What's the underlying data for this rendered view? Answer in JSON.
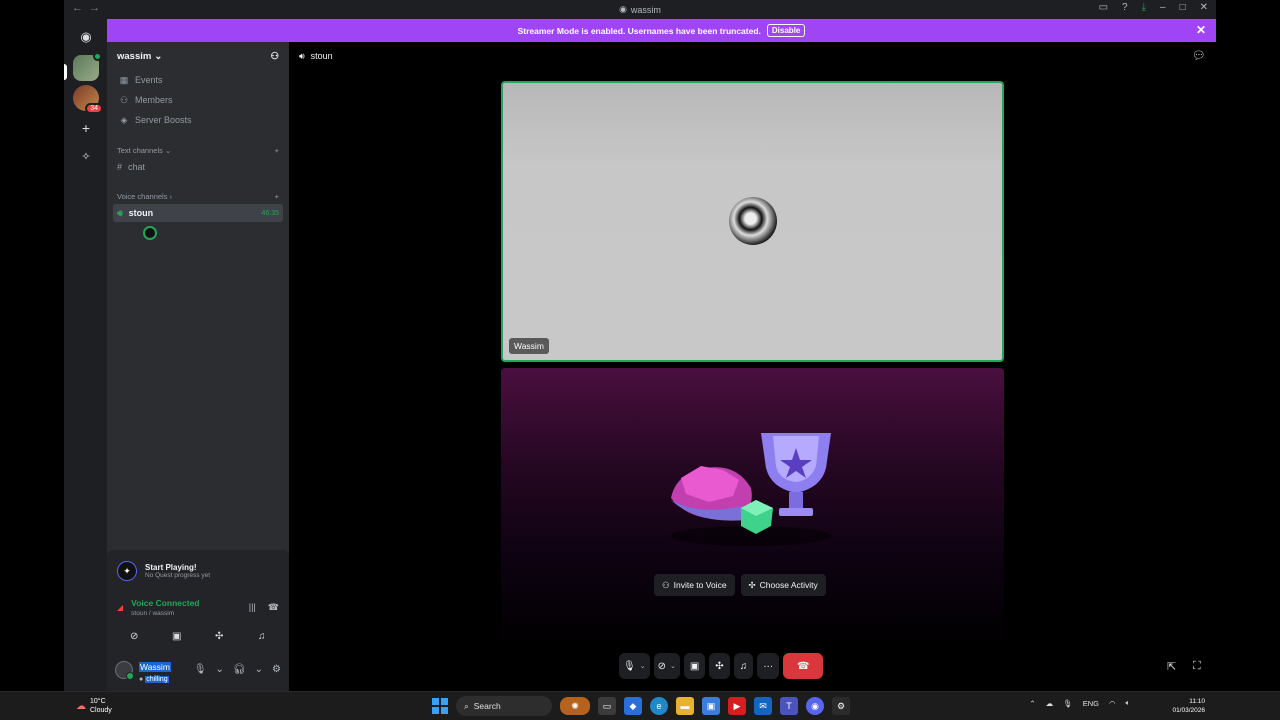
{
  "window": {
    "title": "wassim"
  },
  "banner": {
    "text": "Streamer Mode is enabled. Usernames have been truncated.",
    "action": "Disable"
  },
  "rail": {
    "badge_count": "34"
  },
  "server": {
    "name": "wassim",
    "nav": [
      {
        "label": "Events",
        "icon": "calendar-icon"
      },
      {
        "label": "Members",
        "icon": "members-icon"
      },
      {
        "label": "Server Boosts",
        "icon": "boost-icon"
      }
    ],
    "text_category": "Text channels",
    "text_channels": [
      "chat"
    ],
    "voice_category": "Voice channels",
    "voice_channel": {
      "name": "stoun",
      "timer": "46:35"
    }
  },
  "quest": {
    "title": "Start Playing!",
    "subtitle": "No Quest progress yet"
  },
  "voice_status": {
    "status": "Voice Connected",
    "location": "stoun / wassim"
  },
  "user": {
    "name": "Wassim",
    "status": "chilling"
  },
  "main": {
    "channel": "stoun",
    "tile_label": "Wassim",
    "invite_label": "Invite to Voice",
    "activity_label": "Choose Activity"
  },
  "taskbar": {
    "weather_temp": "10°C",
    "weather_desc": "Cloudy",
    "search_placeholder": "Search",
    "lang": "ENG",
    "time": "11:10",
    "date": "01/03/2026"
  },
  "colors": {
    "accent": "#a045f5",
    "connected": "#23a55a",
    "hangup": "#da373c"
  }
}
